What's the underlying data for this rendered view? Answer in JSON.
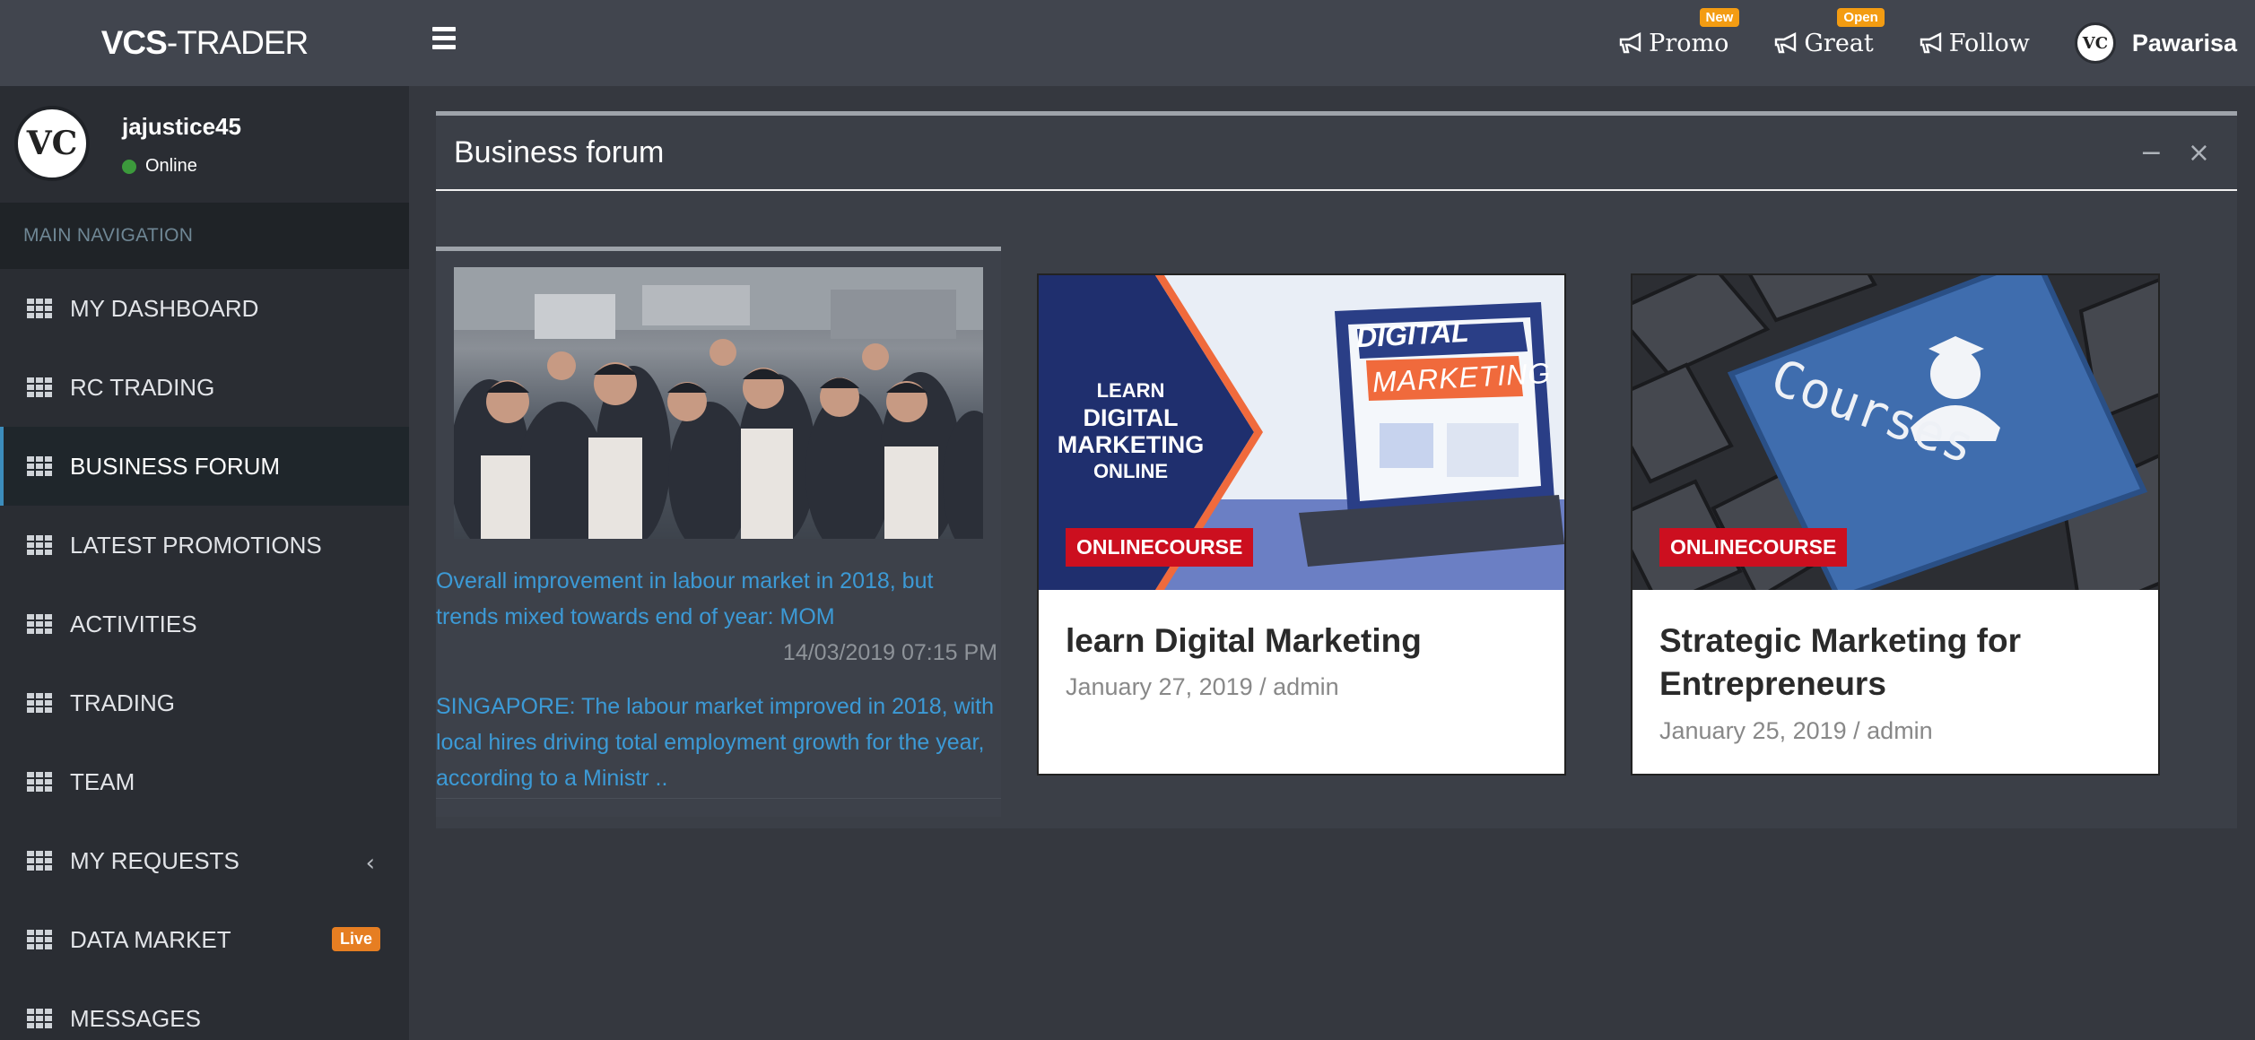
{
  "app": {
    "logo_bold": "VCS",
    "logo_rest": "-TRADER"
  },
  "topbar": {
    "links": [
      {
        "label": "Promo",
        "badge": "New",
        "icon": "megaphone-icon"
      },
      {
        "label": "Great",
        "badge": "Open",
        "icon": "megaphone-icon"
      },
      {
        "label": "Follow",
        "badge": "",
        "icon": "megaphone-icon"
      }
    ],
    "user_name": "Pawarisa"
  },
  "sidebar": {
    "user_name": "jajustice45",
    "status": "Online",
    "nav_header": "MAIN NAVIGATION",
    "items": [
      {
        "label": "MY DASHBOARD"
      },
      {
        "label": "RC TRADING"
      },
      {
        "label": "BUSINESS FORUM",
        "active": true
      },
      {
        "label": "LATEST PROMOTIONS"
      },
      {
        "label": "ACTIVITIES"
      },
      {
        "label": "TRADING"
      },
      {
        "label": "TEAM"
      },
      {
        "label": "MY REQUESTS",
        "chevron": "‹"
      },
      {
        "label": "DATA MARKET",
        "badge": "Live"
      },
      {
        "label": "MESSAGES"
      }
    ]
  },
  "box": {
    "title": "Business forum",
    "minimize": "−",
    "close": "×"
  },
  "news": {
    "title": "Overall improvement in labour market in 2018, but trends mixed towards end of year: MOM",
    "date": "14/03/2019 07:15 PM",
    "excerpt": "SINGAPORE: The labour market improved in 2018, with local hires driving total employment growth for the year, according to a Ministr .."
  },
  "cards": [
    {
      "badge": "ONLINECOURSE",
      "title": "learn Digital Marketing",
      "meta": "January 27, 2019 / admin",
      "image_text": {
        "line1": "LEARN",
        "line2": "DIGITAL",
        "line3": "MARKETING",
        "line4": "ONLINE",
        "screen1": "DIGITAL",
        "screen2": "MARKETING"
      }
    },
    {
      "badge": "ONLINECOURSE",
      "title": "Strategic Marketing for Entrepreneurs",
      "meta": "January 25, 2019 / admin",
      "image_text": {
        "key": "Courses"
      }
    }
  ],
  "colors": {
    "accent_blue": "#3c8dbc",
    "link_blue": "#3c9ad6",
    "badge_red": "#cc0f1f",
    "badge_orange": "#f39c12"
  }
}
